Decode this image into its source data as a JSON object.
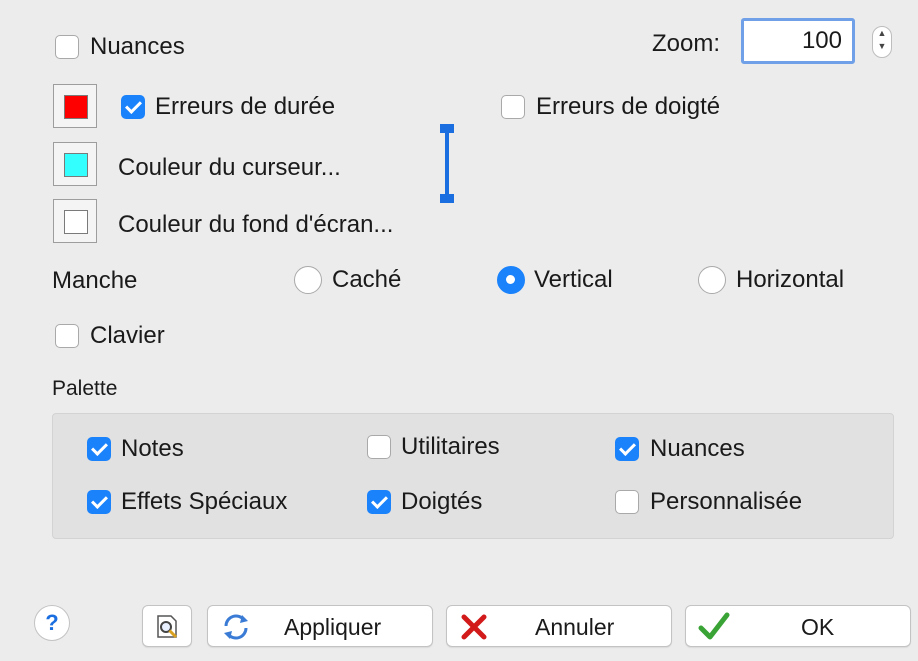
{
  "nuances": {
    "label": "Nuances",
    "checked": false
  },
  "zoom": {
    "label": "Zoom:",
    "value": "100"
  },
  "errors": {
    "duration": {
      "label": "Erreurs de durée",
      "checked": true,
      "color": "#ff0000"
    },
    "fingering": {
      "label": "Erreurs de doigté",
      "checked": false
    }
  },
  "cursor_color": {
    "label": "Couleur du curseur...",
    "color": "#33ffff"
  },
  "background_color": {
    "label": "Couleur du fond d'écran...",
    "color": "#ffffff"
  },
  "neck": {
    "label": "Manche",
    "selected": "Vertical",
    "options": [
      {
        "label": "Caché",
        "selected": false
      },
      {
        "label": "Vertical",
        "selected": true
      },
      {
        "label": "Horizontal",
        "selected": false
      }
    ]
  },
  "keyboard": {
    "label": "Clavier",
    "checked": false
  },
  "palette": {
    "label": "Palette",
    "items": [
      {
        "label": "Notes",
        "checked": true
      },
      {
        "label": "Utilitaires",
        "checked": false
      },
      {
        "label": "Nuances",
        "checked": true
      },
      {
        "label": "Effets Spéciaux",
        "checked": true
      },
      {
        "label": "Doigtés",
        "checked": true
      },
      {
        "label": "Personnalisée",
        "checked": false
      }
    ]
  },
  "buttons": {
    "help": "?",
    "apply": "Appliquer",
    "cancel": "Annuler",
    "ok": "OK"
  },
  "colors": {
    "accent": "#1a82fb",
    "cancel_icon": "#d21a1a",
    "ok_icon": "#3aa335"
  }
}
